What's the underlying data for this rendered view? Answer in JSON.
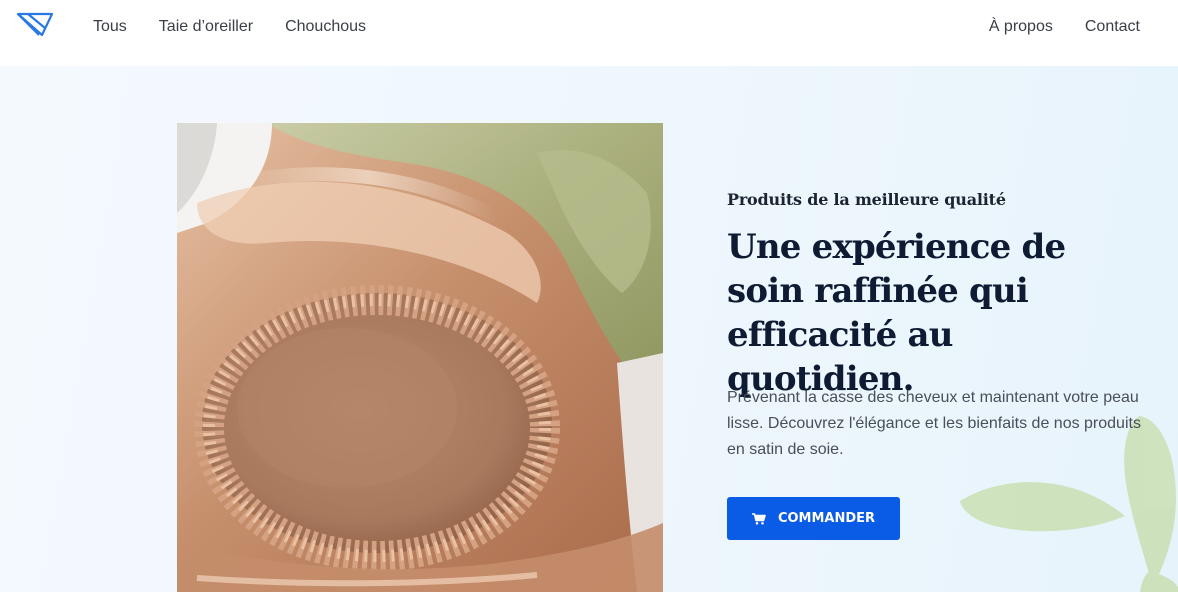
{
  "header": {
    "logo_icon": "diamond-logo-icon",
    "nav_left": [
      "Tous",
      "Taie d’oreiller",
      "Chouchous"
    ],
    "nav_right": [
      "À propos",
      "Contact"
    ]
  },
  "hero": {
    "image": "satin-bonnet-photo",
    "eyebrow": "Produits de la meilleure qualité",
    "headline": "Une expérience de soin raffinée qui efficacité au quotidien.",
    "description": "Prévenant la casse des cheveux et maintenant votre peau lisse. Découvrez l'élégance et les bienfaits de nos produits en satin de soie.",
    "cta": {
      "label": "COMMANDER",
      "icon": "cart-icon"
    }
  },
  "colors": {
    "accent": "#0a5be6",
    "heading": "#0f1b33",
    "hero_bg": "#eef7fd",
    "leaf": "#c9dfb3"
  }
}
